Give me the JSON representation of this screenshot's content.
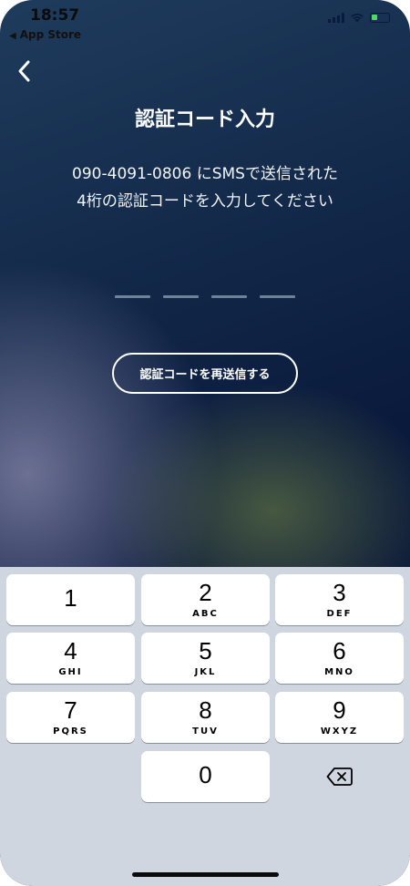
{
  "status_bar": {
    "time": "18:57",
    "back_to_app": "App Store",
    "battery_color": "#4cd964"
  },
  "nav": {
    "back_icon": "chevron-left-icon"
  },
  "screen": {
    "title": "認証コード入力",
    "instruction_line1": "090-4091-0806 にSMSで送信された",
    "instruction_line2": "4桁の認証コードを入力してください",
    "code_length": 4,
    "resend_label": "認証コードを再送信する"
  },
  "keypad": {
    "keys": [
      {
        "digit": "1",
        "letters": ""
      },
      {
        "digit": "2",
        "letters": "ABC"
      },
      {
        "digit": "3",
        "letters": "DEF"
      },
      {
        "digit": "4",
        "letters": "GHI"
      },
      {
        "digit": "5",
        "letters": "JKL"
      },
      {
        "digit": "6",
        "letters": "MNO"
      },
      {
        "digit": "7",
        "letters": "PQRS"
      },
      {
        "digit": "8",
        "letters": "TUV"
      },
      {
        "digit": "9",
        "letters": "WXYZ"
      },
      {
        "digit": "0",
        "letters": ""
      }
    ],
    "delete_icon": "backspace-icon"
  }
}
